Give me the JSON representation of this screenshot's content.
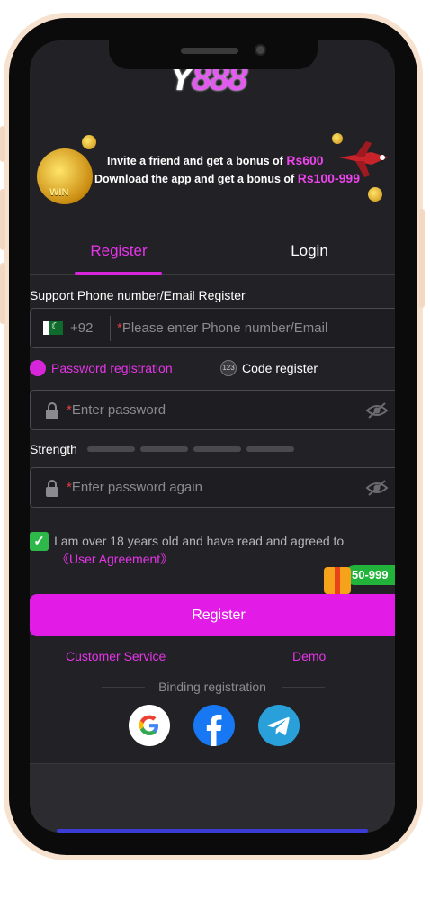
{
  "brand": {
    "logo_prefix": "Y",
    "logo_rest": "888"
  },
  "banner": {
    "line1_text": "Invite a friend and get a bonus of ",
    "line1_amount": "Rs600",
    "line2_text": "Download the app and get a bonus of ",
    "line2_amount": "Rs100-999",
    "badge": "WIN"
  },
  "tabs": {
    "register": "Register",
    "login": "Login"
  },
  "form": {
    "section_label": "Support Phone number/Email Register",
    "country_code": "+92",
    "phone_placeholder": "Please enter Phone number/Email",
    "option_password": "Password registration",
    "option_code": "Code register",
    "option_code_icon": "123",
    "password_placeholder": "Enter password",
    "strength_label": "Strength",
    "strength_level": 0,
    "confirm_placeholder": "Enter password again",
    "required_mark": "*",
    "agree_checked": true,
    "agree_text": "I am over 18 years old and have read and agreed to",
    "agree_link": "《User Agreement》",
    "bonus_pill": "50-999",
    "submit_label": "Register"
  },
  "footer": {
    "customer_service": "Customer Service",
    "demo": "Demo",
    "binding_label": "Binding registration",
    "social": [
      "google-icon",
      "facebook-icon",
      "telegram-icon"
    ]
  },
  "colors": {
    "accent": "#e21ce6",
    "background": "#222226",
    "checkbox": "#2fb84a"
  }
}
